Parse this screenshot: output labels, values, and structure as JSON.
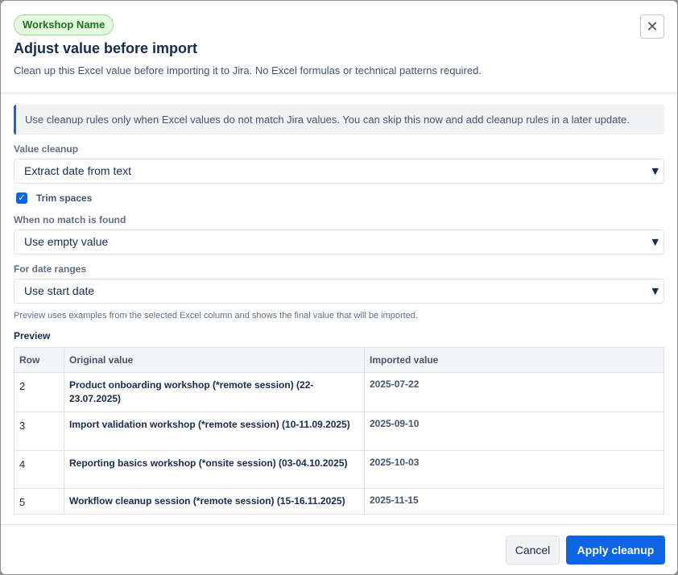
{
  "header": {
    "badge": "Workshop Name",
    "title": "Adjust value before import",
    "subtitle": "Clean up this Excel value before importing it to Jira. No Excel formulas or technical patterns required.",
    "close_glyph": "✕"
  },
  "info_message": "Use cleanup rules only when Excel values do not match Jira values. You can skip this now and add cleanup rules in a later update.",
  "value_cleanup": {
    "label": "Value cleanup",
    "selected": "Extract date from text"
  },
  "trim_spaces": {
    "label": "Trim spaces",
    "checked": true
  },
  "no_match": {
    "label": "When no match is found",
    "selected": "Use empty value"
  },
  "date_ranges": {
    "label": "For date ranges",
    "selected": "Use start date"
  },
  "help_text": "Preview uses examples from the selected Excel column and shows the final value that will be imported.",
  "preview": {
    "title": "Preview",
    "columns": [
      "Row",
      "Original value",
      "Imported value"
    ],
    "rows": [
      {
        "row": "2",
        "original": "Product onboarding workshop (*remote session) (22-23.07.2025)",
        "imported": "2025-07-22"
      },
      {
        "row": "3",
        "original": "Import validation workshop (*remote session) (10-11.09.2025)",
        "imported": "2025-09-10"
      },
      {
        "row": "4",
        "original": "Reporting basics workshop (*onsite session) (03-04.10.2025)",
        "imported": "2025-10-03"
      },
      {
        "row": "5",
        "original": "Workflow cleanup session (*remote session) (15-16.11.2025)",
        "imported": "2025-11-15"
      }
    ]
  },
  "footer": {
    "cancel_label": "Cancel",
    "apply_label": "Apply cleanup"
  },
  "icons": {
    "close": "close-icon",
    "chevron": "chevron-down-icon",
    "check": "checkmark-icon"
  },
  "colors": {
    "accent": "#0c66e4",
    "badge_bg": "#e3fcde",
    "badge_text": "#216e1f"
  }
}
